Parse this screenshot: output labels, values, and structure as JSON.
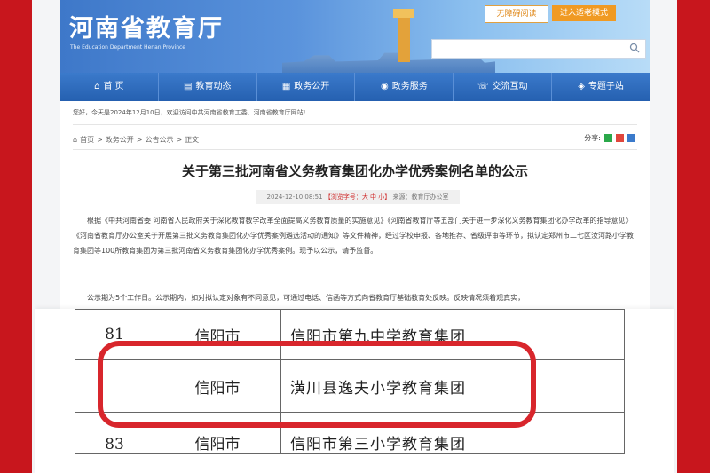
{
  "site": {
    "title": "河南省教育厅",
    "subtitle": "The Education Department Henan Province",
    "accessibility_label": "无障碍阅读",
    "elder_mode_label": "进入适老模式",
    "search_placeholder": ""
  },
  "nav": [
    {
      "icon": "home-icon",
      "label": "首 页"
    },
    {
      "icon": "news-icon",
      "label": "教育动态"
    },
    {
      "icon": "gov-open-icon",
      "label": "政务公开"
    },
    {
      "icon": "service-icon",
      "label": "政务服务"
    },
    {
      "icon": "interaction-icon",
      "label": "交流互动"
    },
    {
      "icon": "topic-icon",
      "label": "专题子站"
    }
  ],
  "greeting": "您好，今天是2024年12月10日，欢迎访问中共河南省教育工委、河南省教育厅网站!",
  "breadcrumb": [
    "首页",
    "政务公开",
    "公告公示",
    "正文"
  ],
  "share_label": "分享:",
  "article": {
    "title": "关于第三批河南省义务教育集团化办学优秀案例名单的公示",
    "date": "2024-12-10 08:51",
    "font_label": "【浏览字号：",
    "font_size_options": "大 中 小】",
    "source": "来源：教育厅办公室",
    "paragraph": "根据《中共河南省委 河南省人民政府关于深化教育教学改革全面提高义务教育质量的实施意见》《河南省教育厅等五部门关于进一步深化义务教育集团化办学改革的指导意见》《河南省教育厅办公室关于开展第三批义务教育集团化办学优秀案例遴选活动的通知》等文件精神，经过学校申报、各地推荐、省级评审等环节，拟认定郑州市二七区汝河路小学教育集团等100所教育集团为第三批河南省义务教育集团化办学优秀案例。现予以公示，请予监督。",
    "notice": "公示期为5个工作日。公示期内，如对拟认定对象有不同意见，可通过电话、信函等方式向省教育厅基础教育处反映。反映情况须着观真实，"
  },
  "table": {
    "rows": [
      {
        "num": "81",
        "city": "信阳市",
        "name": "信阳市第九中学教育集团"
      },
      {
        "num": "",
        "city": "信阳市",
        "name": "潢川县逸夫小学教育集团"
      },
      {
        "num": "83",
        "city": "信阳市",
        "name": "信阳市第三小学教育集团"
      }
    ]
  },
  "colors": {
    "frame": "#c8161d",
    "nav": "#2f6dbf",
    "highlight": "#d8262c",
    "accent_orange": "#f09a23"
  }
}
